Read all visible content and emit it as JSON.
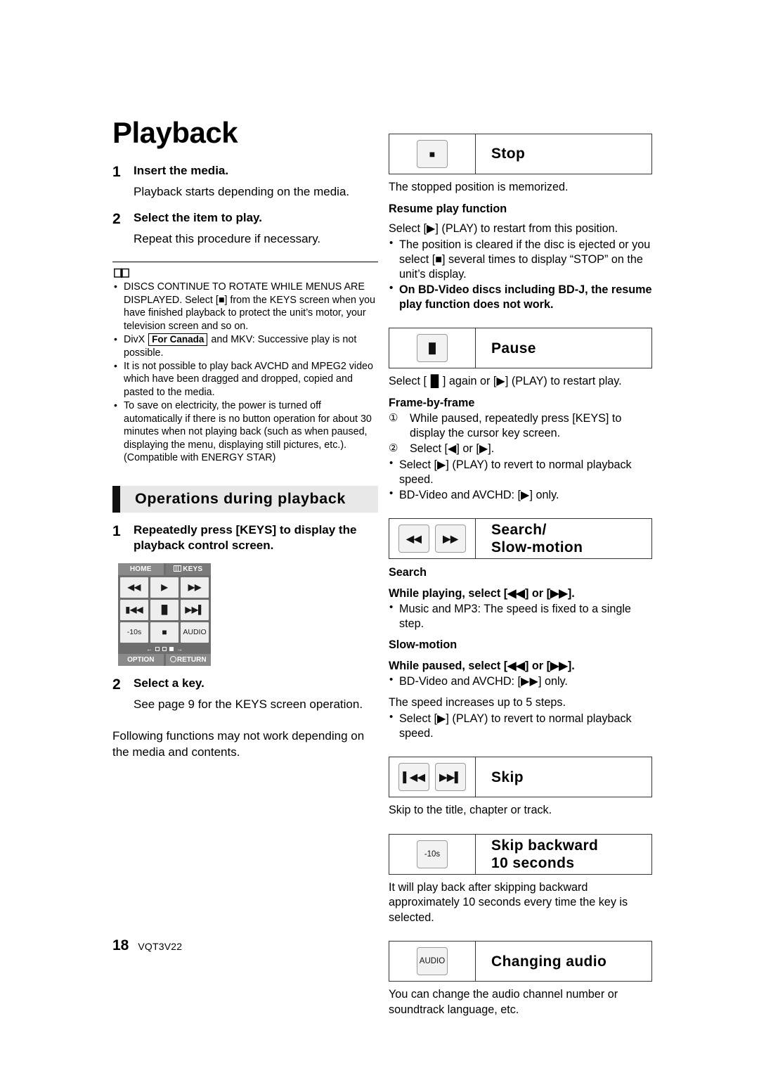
{
  "page": {
    "title": "Playback",
    "footer_page_number": "18",
    "footer_code": "VQT3V22"
  },
  "left_column": {
    "steps": [
      {
        "num": "1",
        "head": "Insert the media.",
        "body": "Playback starts depending on the media."
      },
      {
        "num": "2",
        "head": "Select the item to play.",
        "body": "Repeat this procedure if necessary."
      }
    ],
    "note_icon": "open-book-icon",
    "notes": [
      "DISCS CONTINUE TO ROTATE WHILE MENUS ARE DISPLAYED. Select [■] from the KEYS screen when you have finished playback to protect the unit’s motor, your television screen and so on.",
      "It is not possible to play back AVCHD and MPEG2 video which have been dragged and dropped, copied and pasted to the media.",
      "To save on electricity, the power is turned off automatically if there is no button operation for about 30 minutes when not playing back (such as when paused, displaying the menu, displaying still pictures, etc.). (Compatible with ENERGY STAR)"
    ],
    "divx_note": {
      "prefix": "DivX",
      "boxed": "For Canada",
      "suffix": "and MKV: Successive play is not possible."
    },
    "section_heading": "Operations during playback",
    "ops_steps": [
      {
        "num": "1",
        "head": "Repeatedly press [KEYS] to display the playback control screen."
      },
      {
        "num": "2",
        "head": "Select a key.",
        "body": "See page 9 for the KEYS screen operation."
      }
    ],
    "keys_screen": {
      "tabs": [
        {
          "label": "HOME",
          "icon": ""
        },
        {
          "label": "KEYS",
          "icon": "grid-icon"
        }
      ],
      "grid": [
        "◀◀",
        "▶",
        "▶▶",
        "▮◀◀",
        "▐▌",
        "▶▶▌",
        "-10s",
        "■",
        "AUDIO"
      ],
      "pager": {
        "left_arrow": "←",
        "right_arrow": "→",
        "dots": 3,
        "active_dot": 3
      },
      "bottom_buttons": [
        {
          "label": "OPTION",
          "icon": ""
        },
        {
          "label": "RETURN",
          "icon": "return-arrow-icon"
        }
      ]
    },
    "tail_text": "Following functions may not work depending on the media and contents."
  },
  "right_column": {
    "functions": [
      {
        "name": "stop",
        "keycaps": [
          {
            "glyph": "■",
            "style": "glyph"
          }
        ],
        "title": "Stop",
        "blocks": [
          {
            "type": "text",
            "text": "The stopped position is memorized."
          },
          {
            "type": "subhead",
            "text": "Resume play function"
          },
          {
            "type": "text",
            "text": "Select [▶] (PLAY) to restart from this position."
          },
          {
            "type": "bullets",
            "items": [
              {
                "text": "The position is cleared if the disc is ejected or you select [■] several times to display “STOP” on the unit’s display.",
                "bold": false
              },
              {
                "text": "On BD-Video discs including BD-J, the resume play function does not work.",
                "bold": true
              }
            ]
          }
        ]
      },
      {
        "name": "pause",
        "keycaps": [
          {
            "glyph": "▐▌",
            "style": "glyph"
          }
        ],
        "title": "Pause",
        "blocks": [
          {
            "type": "text",
            "text": "Select [▐▌] again or [▶] (PLAY) to restart play."
          },
          {
            "type": "subhead",
            "text": "Frame-by-frame"
          },
          {
            "type": "circled",
            "items": [
              {
                "num": "①",
                "text": "While paused, repeatedly press [KEYS] to display the cursor key screen."
              },
              {
                "num": "②",
                "text": "Select [◀] or [▶]."
              }
            ]
          },
          {
            "type": "bullets",
            "items": [
              {
                "text": "Select [▶] (PLAY) to revert to normal playback speed.",
                "bold": false
              },
              {
                "text": "BD-Video and AVCHD: [▶] only.",
                "bold": false
              }
            ]
          }
        ]
      },
      {
        "name": "search-slow-motion",
        "keycaps": [
          {
            "glyph": "◀◀",
            "style": "glyph"
          },
          {
            "glyph": "▶▶",
            "style": "glyph"
          }
        ],
        "title": "Search/\nSlow-motion",
        "blocks": [
          {
            "type": "subhead",
            "text": "Search"
          },
          {
            "type": "subhead",
            "text": "While playing, select [◀◀] or [▶▶]."
          },
          {
            "type": "bullets",
            "items": [
              {
                "text": "Music and MP3: The speed is fixed to a single step.",
                "bold": false
              }
            ]
          },
          {
            "type": "subhead",
            "text": "Slow-motion"
          },
          {
            "type": "subhead",
            "text": "While paused, select [◀◀] or [▶▶]."
          },
          {
            "type": "bullets",
            "items": [
              {
                "text": "BD-Video and AVCHD: [▶▶] only.",
                "bold": false
              }
            ]
          },
          {
            "type": "text",
            "text": "The speed increases up to 5 steps."
          },
          {
            "type": "bullets",
            "items": [
              {
                "text": "Select [▶] (PLAY) to revert to normal playback speed.",
                "bold": false
              }
            ]
          }
        ]
      },
      {
        "name": "skip",
        "keycaps": [
          {
            "glyph": "▌◀◀",
            "style": "glyph"
          },
          {
            "glyph": "▶▶▌",
            "style": "glyph"
          }
        ],
        "title": "Skip",
        "blocks": [
          {
            "type": "text",
            "text": "Skip to the title, chapter or track."
          }
        ]
      },
      {
        "name": "skip-backward-10-seconds",
        "keycaps": [
          {
            "glyph": "-10s",
            "style": "text"
          }
        ],
        "title": "Skip backward\n10 seconds",
        "blocks": [
          {
            "type": "text",
            "text": "It will play back after skipping backward approximately 10 seconds every time the key is selected."
          }
        ]
      },
      {
        "name": "changing-audio",
        "keycaps": [
          {
            "glyph": "AUDIO",
            "style": "text"
          }
        ],
        "title": "Changing audio",
        "blocks": [
          {
            "type": "text",
            "text": "You can change the audio channel number or soundtrack language, etc."
          }
        ]
      }
    ]
  }
}
